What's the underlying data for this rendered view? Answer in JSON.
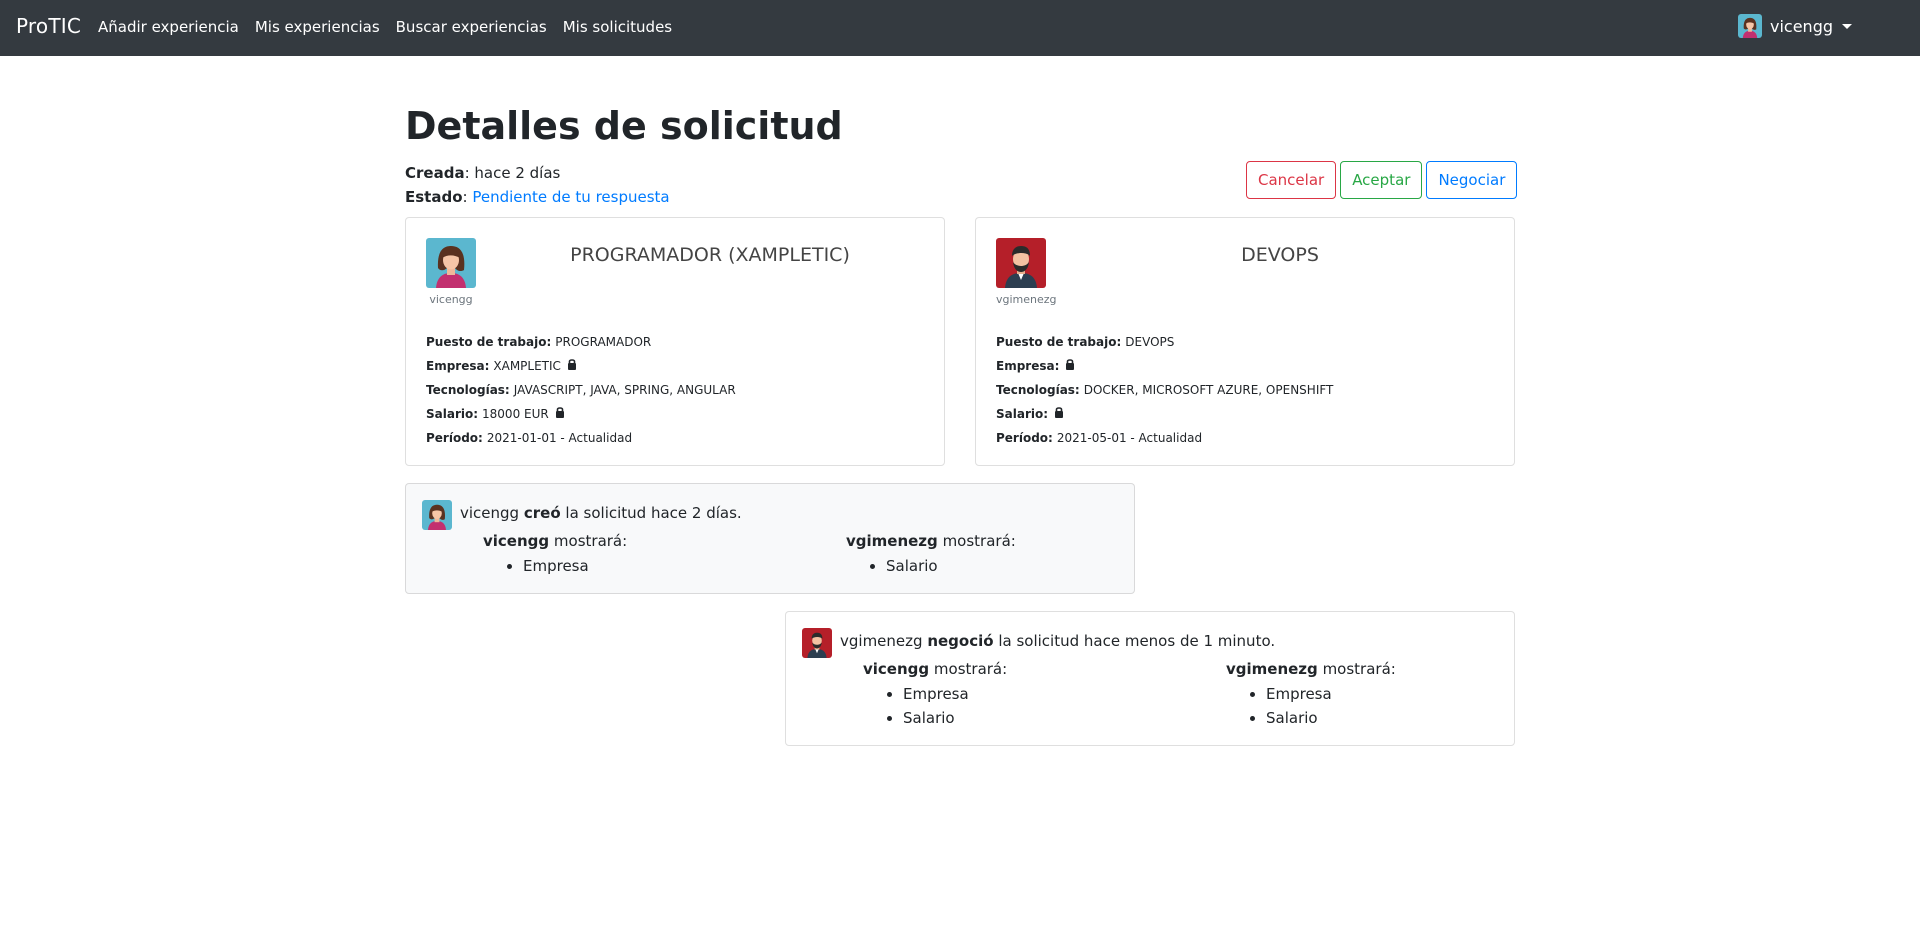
{
  "navbar": {
    "brand": "ProTIC",
    "links": [
      "Añadir experiencia",
      "Mis experiencias",
      "Buscar experiencias",
      "Mis solicitudes"
    ],
    "user": "vicengg"
  },
  "page": {
    "title": "Detalles de solicitud",
    "created_label": "Creada",
    "created_value": "hace 2 días",
    "status_label": "Estado",
    "status_value": "Pendiente de tu respuesta"
  },
  "actions": {
    "cancel": "Cancelar",
    "accept": "Aceptar",
    "negotiate": "Negociar"
  },
  "colors": {
    "navbar_bg": "#343a40",
    "link": "#007bff",
    "danger": "#dc3545",
    "success": "#28a745",
    "avatar_female_bg": "#5bb7cf",
    "avatar_male_bg": "#b51f29"
  },
  "labels": {
    "job": "Puesto de trabajo:",
    "company": "Empresa:",
    "tech": "Tecnologías:",
    "salary": "Salario:",
    "period": "Período:"
  },
  "cards": [
    {
      "user": "vicengg",
      "avatar": "female-avatar-icon",
      "title": "PROGRAMADOR (XAMPLETIC)",
      "job": "PROGRAMADOR",
      "company": "XAMPLETIC",
      "company_locked": true,
      "tech": "JAVASCRIPT, JAVA, SPRING, ANGULAR",
      "salary": "18000 EUR",
      "salary_locked": true,
      "period": "2021-01-01 - Actualidad"
    },
    {
      "user": "vgimenezg",
      "avatar": "male-avatar-icon",
      "title": "DEVOPS",
      "job": "DEVOPS",
      "company": "",
      "company_locked": true,
      "tech": "DOCKER, MICROSOFT AZURE, OPENSHIFT",
      "salary": "",
      "salary_locked": true,
      "period": "2021-05-01 - Actualidad"
    }
  ],
  "timeline": [
    {
      "user": "vicengg",
      "action": "creó",
      "rest": "la solicitud hace 2 días.",
      "shows_label": "mostrará:",
      "cols": [
        {
          "user": "vicengg",
          "items": [
            "Empresa"
          ]
        },
        {
          "user": "vgimenezg",
          "items": [
            "Salario"
          ]
        }
      ]
    },
    {
      "user": "vgimenezg",
      "action": "negoció",
      "rest": "la solicitud hace menos de 1 minuto.",
      "shows_label": "mostrará:",
      "cols": [
        {
          "user": "vicengg",
          "items": [
            "Empresa",
            "Salario"
          ]
        },
        {
          "user": "vgimenezg",
          "items": [
            "Empresa",
            "Salario"
          ]
        }
      ]
    }
  ]
}
